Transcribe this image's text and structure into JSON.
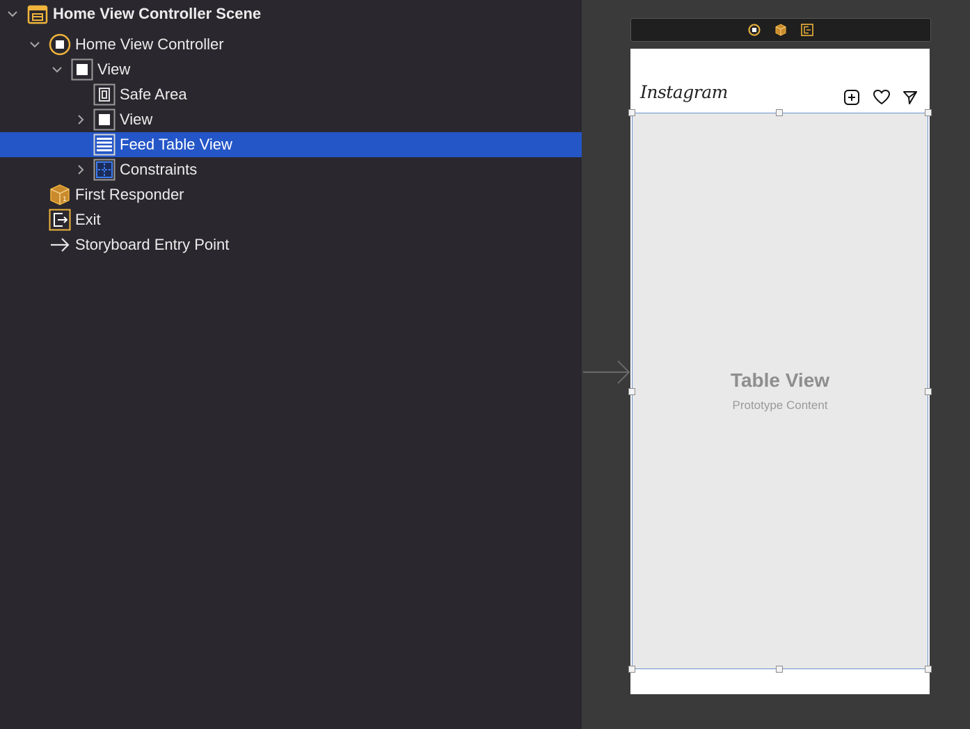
{
  "outline": {
    "rows": [
      {
        "label": "Home View Controller Scene",
        "icon": "scene-icon",
        "disclosure": "expanded"
      },
      {
        "label": "Home View Controller",
        "icon": "view-controller-icon",
        "disclosure": "expanded"
      },
      {
        "label": "View",
        "icon": "view-icon",
        "disclosure": "expanded"
      },
      {
        "label": "Safe Area",
        "icon": "safe-area-icon",
        "disclosure": "none"
      },
      {
        "label": "View",
        "icon": "view-icon",
        "disclosure": "collapsed"
      },
      {
        "label": "Feed Table View",
        "icon": "table-view-icon",
        "disclosure": "none",
        "selected": true
      },
      {
        "label": "Constraints",
        "icon": "constraints-icon",
        "disclosure": "collapsed"
      },
      {
        "label": "First Responder",
        "icon": "first-responder-icon",
        "disclosure": "none"
      },
      {
        "label": "Exit",
        "icon": "exit-icon",
        "disclosure": "none"
      },
      {
        "label": "Storyboard Entry Point",
        "icon": "arrow-right-icon",
        "disclosure": "none"
      }
    ]
  },
  "canvas": {
    "navbar_logo": "Instagram",
    "navbar_icons": [
      "add-post-icon",
      "heart-icon",
      "send-icon"
    ],
    "dock_icons": [
      "view-controller-icon",
      "first-responder-icon",
      "exit-icon"
    ],
    "table_view_title": "Table View",
    "table_view_subtitle": "Prototype Content"
  },
  "colors": {
    "outline_bg": "#2a282e",
    "selection": "#2456c8",
    "canvas_bg": "#3a3a3a",
    "accent_orange": "#f0b43c"
  }
}
